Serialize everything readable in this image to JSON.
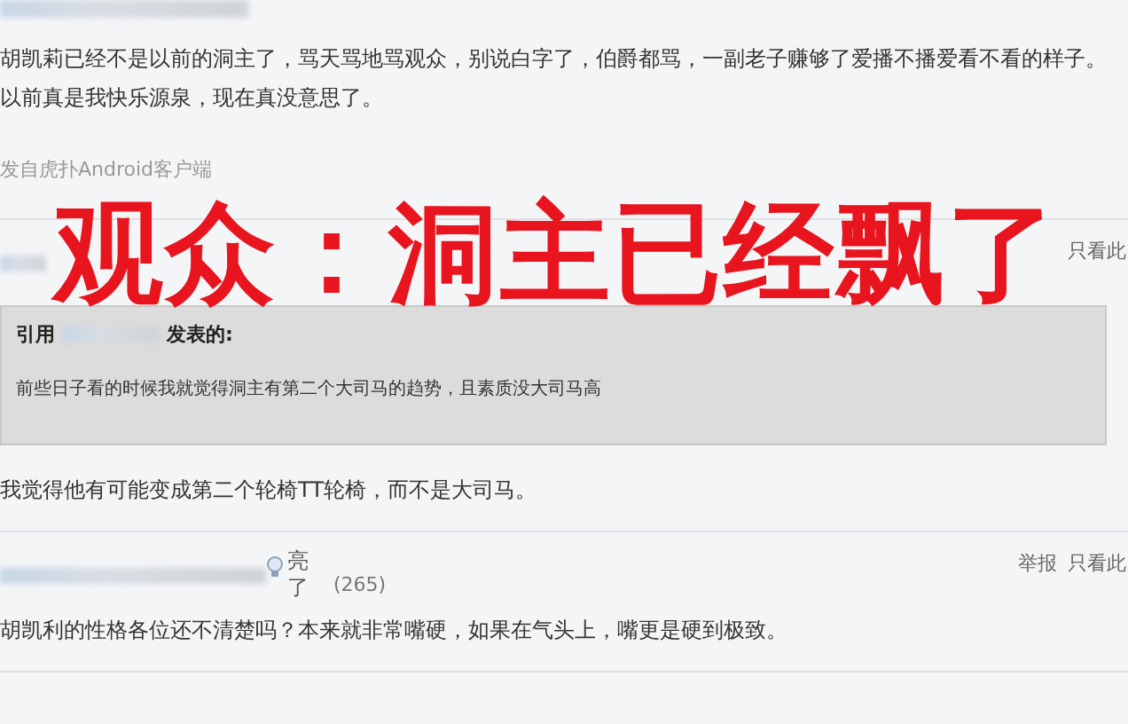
{
  "overlay_caption": "观众：洞主已经飘了",
  "posts": [
    {
      "body": [
        "胡凯莉已经不是以前的洞主了，骂天骂地骂观众，别说白字了，伯爵都骂，一副老子赚够了爱播不播爱看不看的样子。",
        "以前真是我快乐源泉，现在真没意思了。"
      ],
      "source": "发自虎扑Android客户端"
    },
    {
      "header": {
        "only_this": "只看此"
      },
      "quote": {
        "prefix": "引用",
        "suffix": "发表的:",
        "text": "前些日子看的时候我就觉得洞主有第二个大司马的趋势，且素质没大司马高"
      },
      "body": [
        "我觉得他有可能变成第二个轮椅TT轮椅，而不是大司马。"
      ]
    },
    {
      "header": {
        "light_top": "亮",
        "light_bottom": "了",
        "count": "(265)",
        "report": "举报",
        "only_this": "只看此"
      },
      "body": [
        "胡凯利的性格各位还不清楚吗？本来就非常嘴硬，如果在气头上，嘴更是硬到极致。"
      ]
    }
  ]
}
